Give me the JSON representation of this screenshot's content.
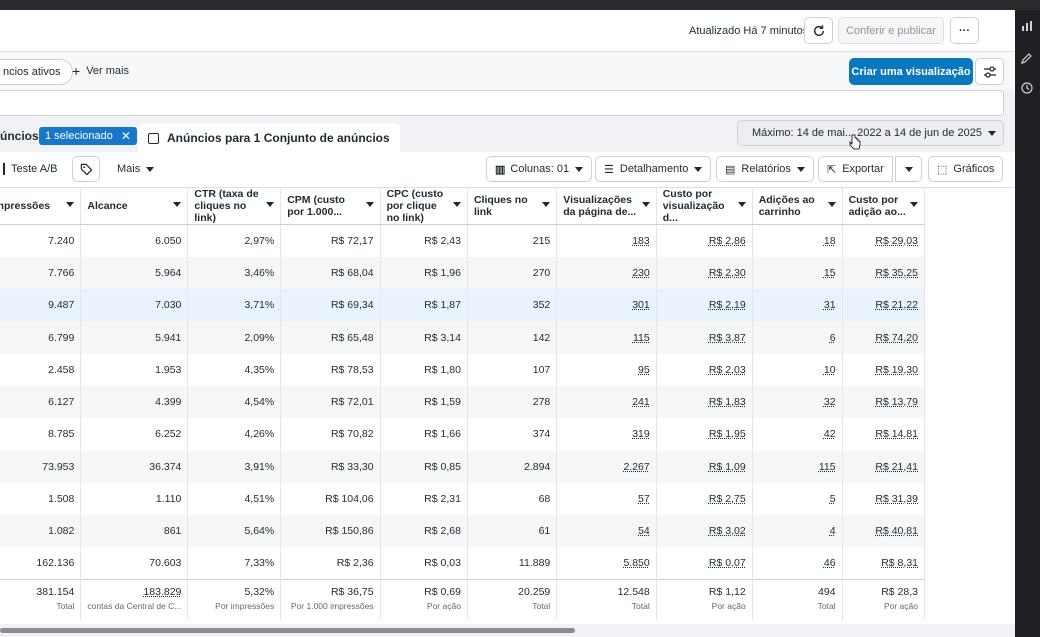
{
  "header": {
    "updated_text": "Atualizado Há 7 minutos",
    "publish_label": "Conferir e publicar",
    "more_label": "···"
  },
  "filters": {
    "active_pill": "ncios ativos",
    "see_more": "Ver mais",
    "create_view": "Criar uma visualização"
  },
  "selection": {
    "section_label": "úncios",
    "selected_chip": "1 selecionado",
    "tab_label": "Anúncios para 1 Conjunto de anúncios",
    "date_range": "Máximo: 14 de mai... 2022 a 14 de jun de 2025"
  },
  "toolbar": {
    "ab_test": "Teste A/B",
    "more": "Mais",
    "columns": "Colunas: 01",
    "breakdown": "Detalhamento",
    "reports": "Relatórios",
    "export": "Exportar",
    "charts": "Gráficos"
  },
  "table": {
    "headers": [
      "Impressões",
      "Alcance",
      "CTR (taxa de cliques no link)",
      "CPM (custo por 1.000...",
      "CPC (custo por clique no link)",
      "Cliques no link",
      "Visualizações da página de...",
      "Custo por visualização d...",
      "Adições ao carrinho",
      "Custo por adição ao..."
    ],
    "rows": [
      [
        "7.240",
        "6.050",
        "2,97%",
        "R$ 72,17",
        "R$ 2,43",
        "215",
        "183",
        "R$ 2,86",
        "18",
        "R$ 29,03"
      ],
      [
        "7.766",
        "5.964",
        "3,46%",
        "R$ 68,04",
        "R$ 1,96",
        "270",
        "230",
        "R$ 2,30",
        "15",
        "R$ 35,25"
      ],
      [
        "9.487",
        "7.030",
        "3,71%",
        "R$ 69,34",
        "R$ 1,87",
        "352",
        "301",
        "R$ 2,19",
        "31",
        "R$ 21,22"
      ],
      [
        "6.799",
        "5.941",
        "2,09%",
        "R$ 65,48",
        "R$ 3,14",
        "142",
        "115",
        "R$ 3,87",
        "6",
        "R$ 74,20"
      ],
      [
        "2.458",
        "1.953",
        "4,35%",
        "R$ 78,53",
        "R$ 1,80",
        "107",
        "95",
        "R$ 2,03",
        "10",
        "R$ 19,30"
      ],
      [
        "6.127",
        "4.399",
        "4,54%",
        "R$ 72,01",
        "R$ 1,59",
        "278",
        "241",
        "R$ 1,83",
        "32",
        "R$ 13,79"
      ],
      [
        "8.785",
        "6.252",
        "4,26%",
        "R$ 70,82",
        "R$ 1,66",
        "374",
        "319",
        "R$ 1,95",
        "42",
        "R$ 14,81"
      ],
      [
        "73.953",
        "36.374",
        "3,91%",
        "R$ 33,30",
        "R$ 0,85",
        "2.894",
        "2.267",
        "R$ 1,09",
        "115",
        "R$ 21,41"
      ],
      [
        "1.508",
        "1.110",
        "4,51%",
        "R$ 104,06",
        "R$ 2,31",
        "68",
        "57",
        "R$ 2,75",
        "5",
        "R$ 31,39"
      ],
      [
        "1.082",
        "861",
        "5,64%",
        "R$ 150,86",
        "R$ 2,68",
        "61",
        "54",
        "R$ 3,02",
        "4",
        "R$ 40,81"
      ],
      [
        "162.136",
        "70.603",
        "7,33%",
        "R$ 2,36",
        "R$ 0,03",
        "11.889",
        "5.850",
        "R$ 0,07",
        "46",
        "R$ 8,31"
      ]
    ],
    "totals": [
      {
        "value": "381.154",
        "sub": "Total"
      },
      {
        "value": "183.829",
        "sub": "contas da Central de C..."
      },
      {
        "value": "5,32%",
        "sub": "Por impressões"
      },
      {
        "value": "R$ 36,75",
        "sub": "Por 1.000 impressões"
      },
      {
        "value": "R$ 0,69",
        "sub": "Por ação"
      },
      {
        "value": "20.259",
        "sub": "Total"
      },
      {
        "value": "12.548",
        "sub": "Total"
      },
      {
        "value": "R$ 1,12",
        "sub": "Por ação"
      },
      {
        "value": "494",
        "sub": "Total"
      },
      {
        "value": "R$ 28,3",
        "sub": "Por ação"
      }
    ]
  }
}
